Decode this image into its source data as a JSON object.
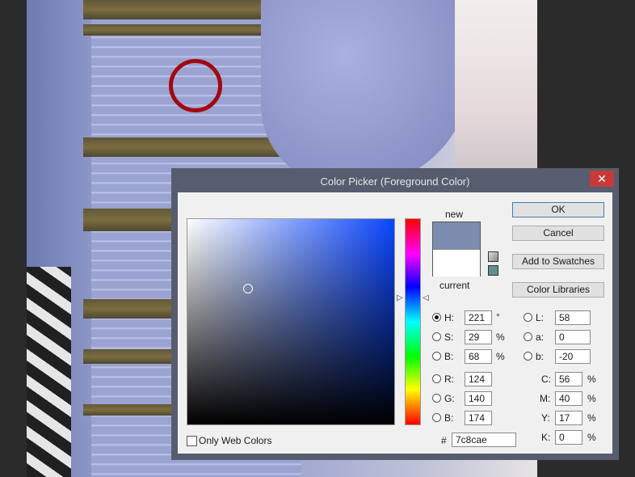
{
  "dialog": {
    "title": "Color Picker (Foreground Color)",
    "close_glyph": "✕",
    "new_label": "new",
    "current_label": "current",
    "new_color": "#7c8cae",
    "current_color": "#ffffff",
    "buttons": {
      "ok": "OK",
      "cancel": "Cancel",
      "add_to_swatches": "Add to Swatches",
      "color_libraries": "Color Libraries"
    },
    "hsb": {
      "h_label": "H:",
      "h_value": "221",
      "h_unit": "°",
      "s_label": "S:",
      "s_value": "29",
      "s_unit": "%",
      "b_label": "B:",
      "b_value": "68",
      "b_unit": "%"
    },
    "rgb": {
      "r_label": "R:",
      "r_value": "124",
      "g_label": "G:",
      "g_value": "140",
      "b_label": "B:",
      "b_value": "174"
    },
    "lab": {
      "l_label": "L:",
      "l_value": "58",
      "a_label": "a:",
      "a_value": "0",
      "b_label": "b:",
      "b_value": "-20"
    },
    "cmyk": {
      "c_label": "C:",
      "c_value": "56",
      "c_unit": "%",
      "m_label": "M:",
      "m_value": "40",
      "m_unit": "%",
      "y_label": "Y:",
      "y_value": "17",
      "y_unit": "%",
      "k_label": "K:",
      "k_value": "0",
      "k_unit": "%"
    },
    "hex_label": "#",
    "hex_value": "7c8cae",
    "only_web_colors": "Only Web Colors"
  },
  "colors": {
    "accent_circle": "#a2080d",
    "dialog_frame": "#575d6e",
    "close_button": "#c83a3a"
  }
}
